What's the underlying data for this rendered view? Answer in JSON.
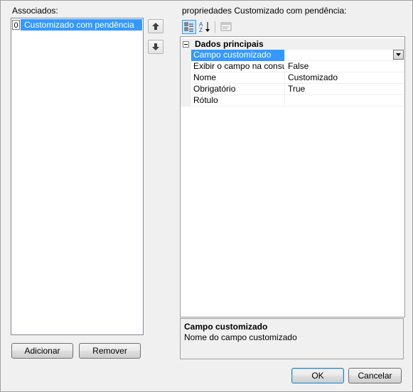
{
  "left_panel": {
    "label": "Associados:",
    "items": [
      {
        "index": "0",
        "label": "Customizado com pendência"
      }
    ],
    "add_button": "Adicionar",
    "remove_button": "Remover"
  },
  "right_panel": {
    "label": "propriedades Customizado com pendência:",
    "category": "Dados principais",
    "properties": [
      {
        "name": "Campo customizado",
        "value": ""
      },
      {
        "name": "Exibir o campo na consulta",
        "value": "False"
      },
      {
        "name": "Nome",
        "value": "Customizado"
      },
      {
        "name": "Obrigatório",
        "value": "True"
      },
      {
        "name": "Rótulo",
        "value": ""
      }
    ],
    "description_title": "Campo customizado",
    "description_text": "Nome do campo customizado"
  },
  "footer": {
    "ok_button": "OK",
    "cancel_button": "Cancelar"
  },
  "colors": {
    "selection": "#3399ff",
    "background": "#f0f0f0"
  }
}
